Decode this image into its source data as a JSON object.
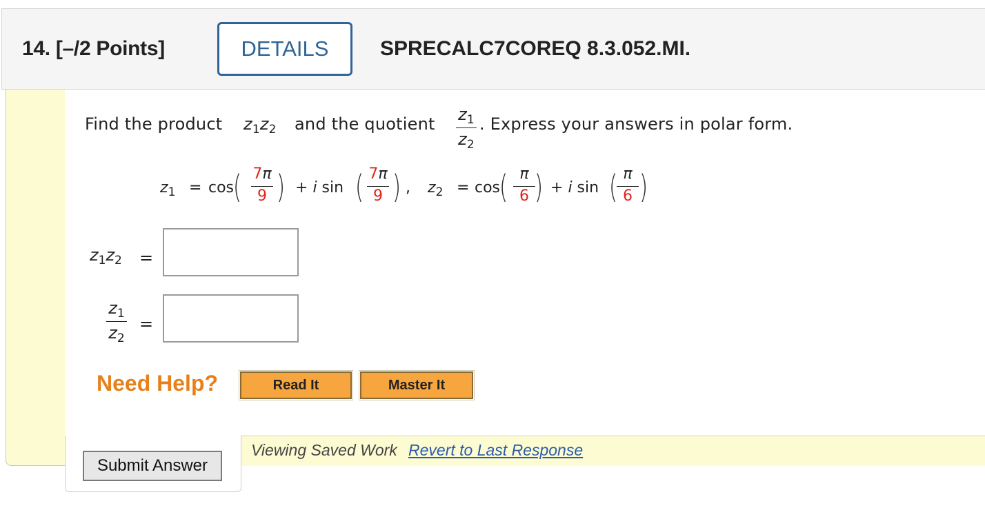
{
  "header": {
    "question_number": "14.",
    "points": "[–/2 Points]",
    "details_label": "DETAILS",
    "question_id": "SPRECALC7COREQ 8.3.052.MI."
  },
  "prompt": {
    "part1": "Find the product",
    "product_expr": "z₁z₂",
    "part2": "and the quotient",
    "quotient_num": "z₁",
    "quotient_den": "z₂",
    "part3": ". Express your answers in polar form."
  },
  "equation": {
    "z1_label": "z₁",
    "equals": "=",
    "cos": "cos",
    "plus_i_sin": "+ i sin",
    "comma": ",",
    "z2_label": "z₂",
    "z1_num": "7",
    "z1_den": "9",
    "z2_num": "",
    "z2_den": "6",
    "pi": "π"
  },
  "answers": {
    "product_label": "z₁z₂",
    "quotient_num": "z₁",
    "quotient_den": "z₂",
    "equals": "=",
    "product_value": "",
    "quotient_value": ""
  },
  "help": {
    "need_help": "Need Help?",
    "read_it": "Read It",
    "master_it": "Master It"
  },
  "footer": {
    "viewing_saved": "Viewing Saved Work",
    "revert_link": "Revert to Last Response",
    "submit_label": "Submit Answer"
  },
  "colors": {
    "accent_blue": "#2f6495",
    "fraction_red": "#e0251c",
    "help_orange": "#e8801a",
    "button_orange": "#f7a53f",
    "panel_yellow": "#fdfbd2"
  }
}
